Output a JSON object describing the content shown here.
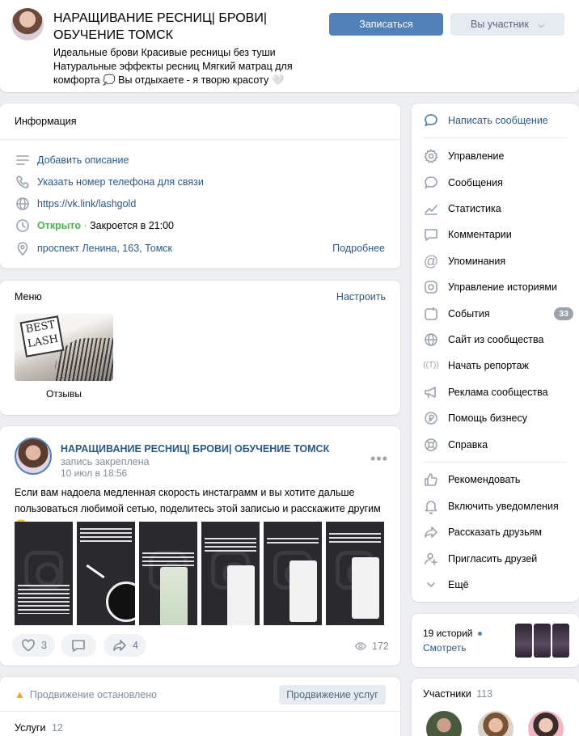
{
  "header": {
    "title": "НАРАЩИВАНИЕ РЕСНИЦ| БРОВИ| ОБУЧЕНИЕ ТОМСК",
    "status": "Идеальные брови Красивые ресницы без туши Натуральные эффекты ресниц Мягкий матрац для комфорта 💭 Вы отдыхаете - я творю красоту 🤍",
    "subscribe": "Записаться",
    "member": "Вы участник"
  },
  "info": {
    "title": "Информация",
    "add_description": "Добавить описание",
    "add_phone": "Указать номер телефона для связи",
    "link": "https://vk.link/lashgold",
    "open": "Открыто",
    "open_dot": " · ",
    "closes": "Закроется в 21:00",
    "address": "проспект Ленина, 163, Томск",
    "more": "Подробнее"
  },
  "menu": {
    "title": "Меню",
    "configure": "Настроить",
    "item_label": "Отзывы",
    "logo_text": "BEST LASH"
  },
  "post": {
    "author": "НАРАЩИВАНИЕ РЕСНИЦ| БРОВИ| ОБУЧЕНИЕ ТОМСК",
    "pinned_suffix": " запись закреплена",
    "date": "10 июл в 18:56",
    "text": "Если вам надоела медленная скорость инстаграмм и вы хотите дальше пользоваться любимой сетью, поделитесь этой записью и расскажите другим 😘",
    "likes": "3",
    "shares": "4",
    "views": "172"
  },
  "promo": {
    "stopped": "Продвижение остановлено",
    "button": "Продвижение услуг",
    "services_label": "Услуги",
    "services_count": "12"
  },
  "sidebar": {
    "items": [
      {
        "label": "Написать сообщение"
      },
      {
        "label": "Управление"
      },
      {
        "label": "Сообщения"
      },
      {
        "label": "Статистика"
      },
      {
        "label": "Комментарии"
      },
      {
        "label": "Упоминания"
      },
      {
        "label": "Управление историями"
      },
      {
        "label": "События",
        "badge": "33"
      },
      {
        "label": "Сайт из сообщества"
      },
      {
        "label": "Начать репортаж"
      },
      {
        "label": "Реклама сообщества"
      },
      {
        "label": "Помощь бизнесу"
      },
      {
        "label": "Справка"
      },
      {
        "label": "Рекомендовать"
      },
      {
        "label": "Включить уведомления"
      },
      {
        "label": "Рассказать друзьям"
      },
      {
        "label": "Пригласить друзей"
      },
      {
        "label": "Ещё"
      }
    ]
  },
  "stories": {
    "count": "19 историй",
    "watch": "Смотреть"
  },
  "members": {
    "label": "Участники",
    "count": "113"
  },
  "colors": {
    "accent": "#5181b8",
    "link": "#2a5885",
    "open": "#4bb34b",
    "page_bg": "#edeef0"
  }
}
